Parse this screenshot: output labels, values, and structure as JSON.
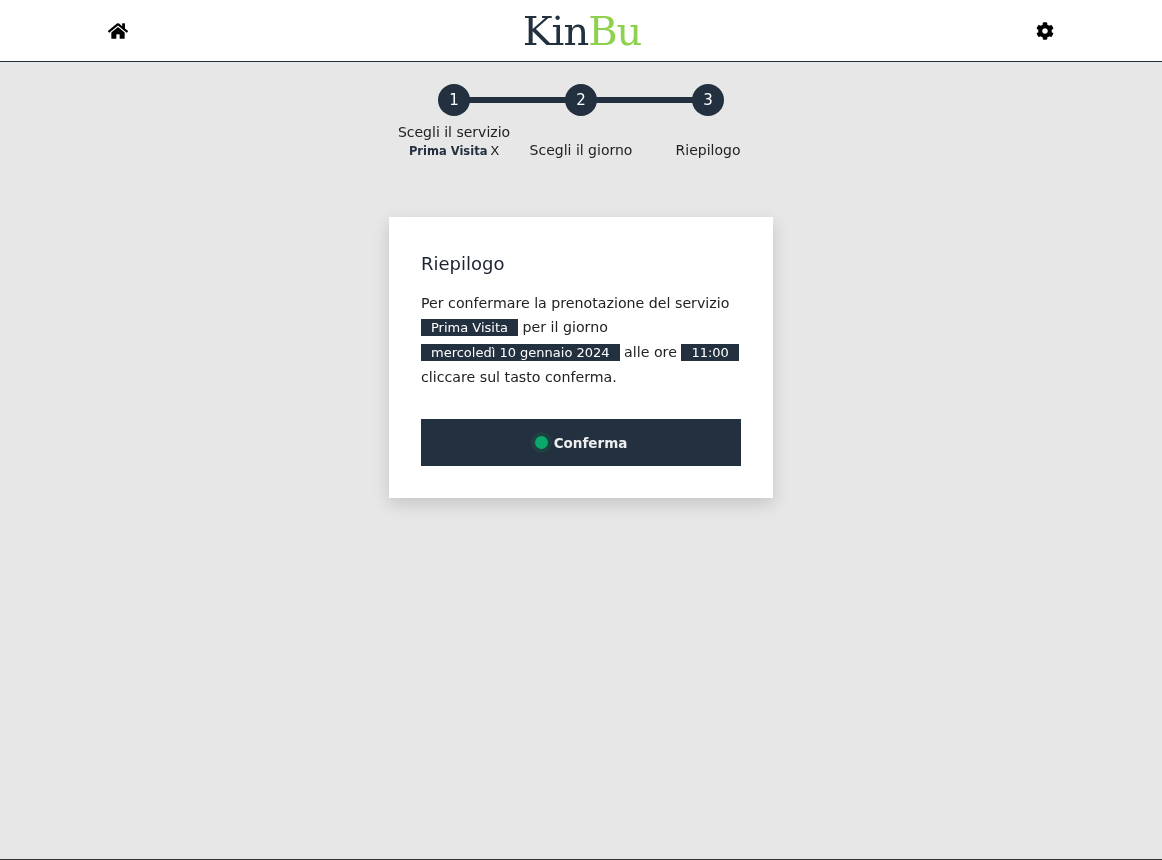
{
  "header": {
    "logo": [
      "Kin",
      "Bu"
    ]
  },
  "steps": [
    {
      "number": "1",
      "label": "Scegli il servizio",
      "choice": "Prima Visita",
      "remove": "X"
    },
    {
      "number": "2",
      "label": "Scegli il giorno"
    },
    {
      "number": "3",
      "label": "Riepilogo"
    }
  ],
  "card": {
    "title": "Riepilogo",
    "segments": [
      {
        "kind": "text",
        "text": "Per confermare la prenotazione del servizio"
      },
      {
        "kind": "chip",
        "text": "Prima Visita"
      },
      {
        "kind": "text",
        "text": "per il giorno"
      },
      {
        "kind": "chip",
        "text": "mercoledì 10 gennaio 2024"
      },
      {
        "kind": "text",
        "text": "alle ore"
      },
      {
        "kind": "chip",
        "text": "11:00"
      },
      {
        "kind": "text",
        "text": "cliccare sul tasto conferma."
      }
    ],
    "button": "Conferma"
  }
}
